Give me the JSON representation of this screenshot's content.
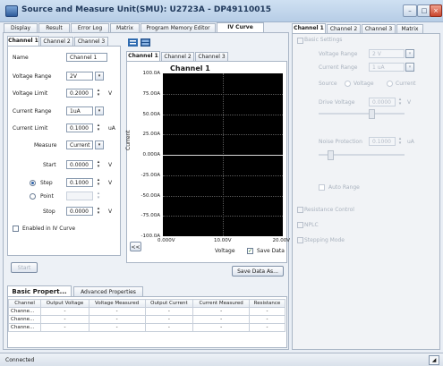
{
  "window": {
    "title": "Source and Measure Unit(SMU): U2723A - DP49110015"
  },
  "main_tabs": [
    "Display",
    "Result",
    "Error Log",
    "Matrix",
    "Program Memory Editor",
    "IV Curve"
  ],
  "channel_tabs": [
    "Channel 1",
    "Channel 2",
    "Channel 3"
  ],
  "form": {
    "name_label": "Name",
    "name_value": "Channel 1",
    "vrange_label": "Voltage Range",
    "vrange_value": "2V",
    "vlimit_label": "Voltage Limit",
    "vlimit_value": "0.2000",
    "vlimit_unit": "V",
    "crange_label": "Current Range",
    "crange_value": "1uA",
    "climit_label": "Current Limit",
    "climit_value": "0.1000",
    "climit_unit": "uA",
    "measure_label": "Measure",
    "measure_value": "Current",
    "start_label": "Start",
    "start_value": "0.0000",
    "start_unit": "V",
    "step_label": "Step",
    "step_value": "0.1000",
    "step_unit": "V",
    "point_label": "Point",
    "point_value": "",
    "stop_label": "Stop",
    "stop_value": "0.0000",
    "stop_unit": "V",
    "enable_label": "Enabled in IV Curve"
  },
  "start_button": "Start",
  "chart_tabs": [
    "Channel 1",
    "Channel 2",
    "Channel 3"
  ],
  "chart_data": {
    "type": "line",
    "title": "Channel 1",
    "xlabel": "Voltage",
    "ylabel": "Current",
    "xlim": [
      0,
      20
    ],
    "ylim": [
      -100,
      100
    ],
    "x_ticks": [
      "0.000V",
      "10.00V",
      "20.00V"
    ],
    "y_ticks": [
      "100.0A",
      "75.00A",
      "50.00A",
      "25.00A",
      "0.000A",
      "-25.00A",
      "-50.00A",
      "-75.00A",
      "-100.0A"
    ],
    "series": [],
    "grid": true
  },
  "chart_controls": {
    "collapse_label": "<<",
    "save_data_label": "Save Data",
    "save_data_as_label": "Save Data As..."
  },
  "bottom_tabs": [
    "Basic Propert...",
    "Advanced Properties"
  ],
  "results_table": {
    "headers": [
      "Channel",
      "Output Voltage",
      "Voltage Measured",
      "Output Current",
      "Current Measured",
      "Resistance"
    ],
    "rows": [
      [
        "Channe...",
        "-",
        "-",
        "-",
        "-",
        "-"
      ],
      [
        "Channe...",
        "-",
        "-",
        "-",
        "-",
        "-"
      ],
      [
        "Channe...",
        "-",
        "-",
        "-",
        "-",
        "-"
      ]
    ]
  },
  "right_tabs": [
    "Channel 1",
    "Channel 2",
    "Channel 3",
    "Matrix"
  ],
  "right_panel": {
    "basic_settings": "Basic Settings",
    "vrange_label": "Voltage Range",
    "vrange_value": "2 V",
    "crange_label": "Current Range",
    "crange_value": "1 uA",
    "source_label": "Source",
    "source_opt1": "Voltage",
    "source_opt2": "Current",
    "drive_label": "Drive Voltage",
    "drive_value": "0.0000",
    "drive_unit": "V",
    "noise_label": "Noise Protection",
    "noise_value": "0.1000",
    "noise_unit": "uA",
    "auto_range_label": "Auto Range",
    "resistance_control": "Resistance Control",
    "nplc": "NPLC",
    "stepping_mode": "Stepping Mode"
  },
  "status": {
    "text": "Connected"
  }
}
